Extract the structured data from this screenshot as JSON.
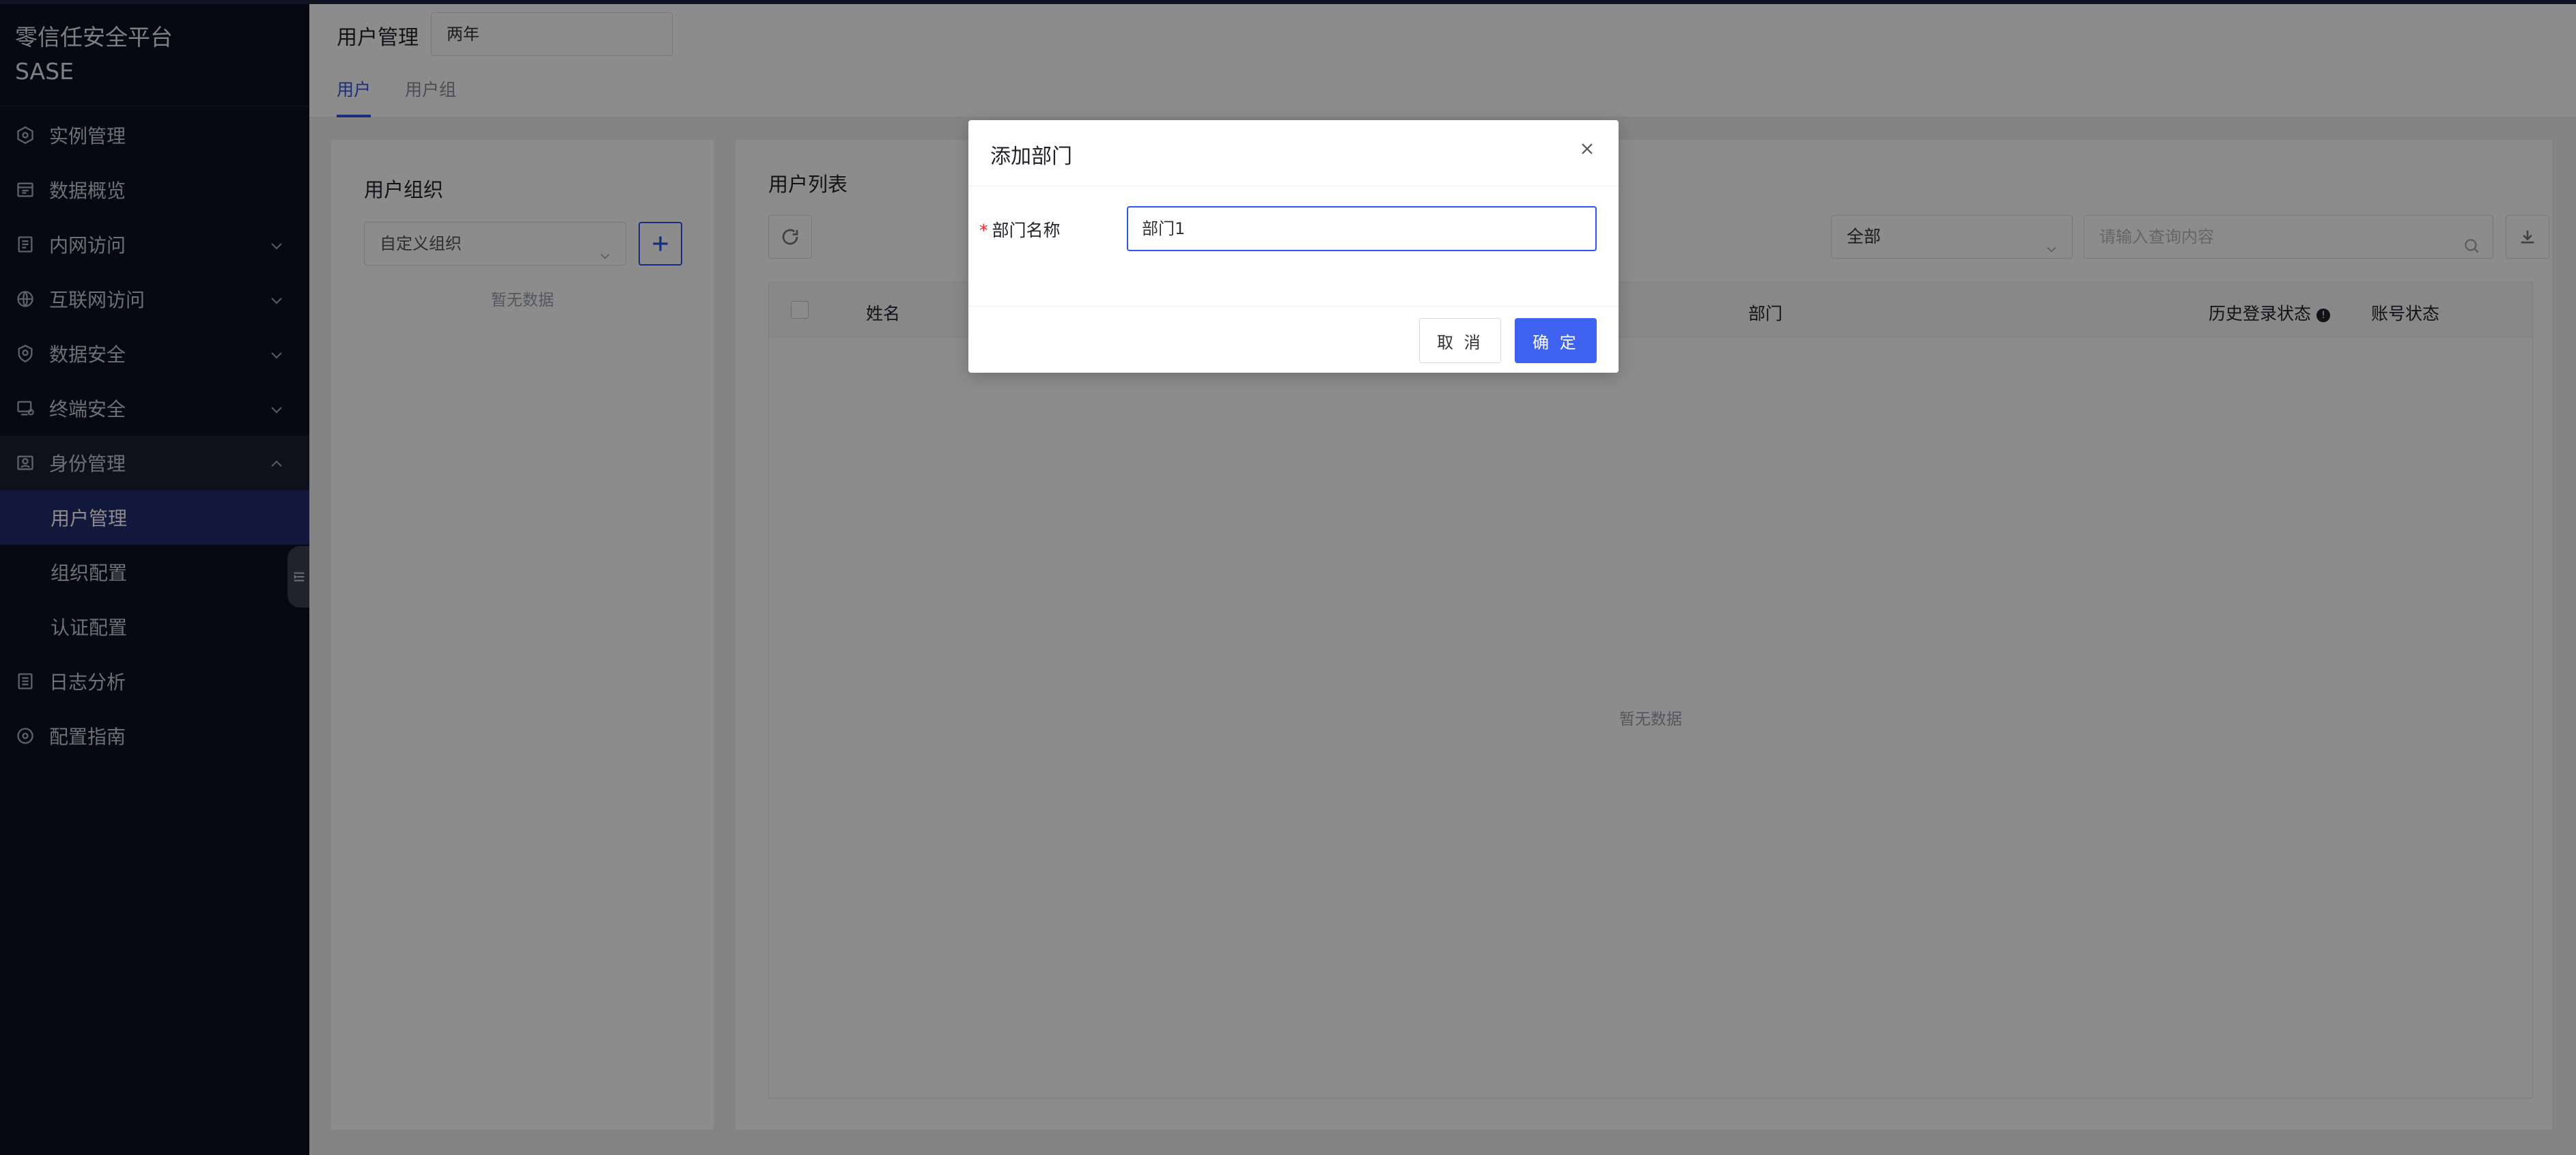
{
  "brand": {
    "line1": "零信任安全平台",
    "line2": "SASE"
  },
  "sidebar": {
    "items": [
      {
        "label": "实例管理",
        "icon": "instance-icon"
      },
      {
        "label": "数据概览",
        "icon": "dashboard-icon"
      },
      {
        "label": "内网访问",
        "icon": "intranet-icon",
        "expandable": true
      },
      {
        "label": "互联网访问",
        "icon": "globe-icon",
        "expandable": true
      },
      {
        "label": "数据安全",
        "icon": "shield-icon",
        "expandable": true
      },
      {
        "label": "终端安全",
        "icon": "device-icon",
        "expandable": true
      },
      {
        "label": "身份管理",
        "icon": "identity-icon",
        "expandable": true,
        "open": true,
        "children": [
          {
            "label": "用户管理",
            "active": true
          },
          {
            "label": "组织配置"
          },
          {
            "label": "认证配置"
          }
        ]
      },
      {
        "label": "日志分析",
        "icon": "log-icon"
      },
      {
        "label": "配置指南",
        "icon": "guide-icon"
      }
    ]
  },
  "header": {
    "title": "用户管理",
    "input_value": "两年",
    "tabs": [
      {
        "label": "用户",
        "active": true
      },
      {
        "label": "用户组"
      }
    ]
  },
  "left_panel": {
    "title": "用户组织",
    "select_value": "自定义组织",
    "empty_text": "暂无数据"
  },
  "right_panel": {
    "title": "用户列表",
    "filter_value": "全部",
    "search_placeholder": "请输入查询内容",
    "columns": {
      "name": "姓名",
      "department": "部门",
      "history_login": "历史登录状态",
      "account_status": "账号状态"
    },
    "empty_text": "暂无数据"
  },
  "modal": {
    "title": "添加部门",
    "field_label": "部门名称",
    "field_value": "部门1",
    "cancel_label": "取 消",
    "ok_label": "确 定"
  },
  "colors": {
    "sidebar_bg": "#0c1122",
    "active_item": "#1f2d6e",
    "primary": "#3f63f0",
    "required": "#f5222d"
  }
}
